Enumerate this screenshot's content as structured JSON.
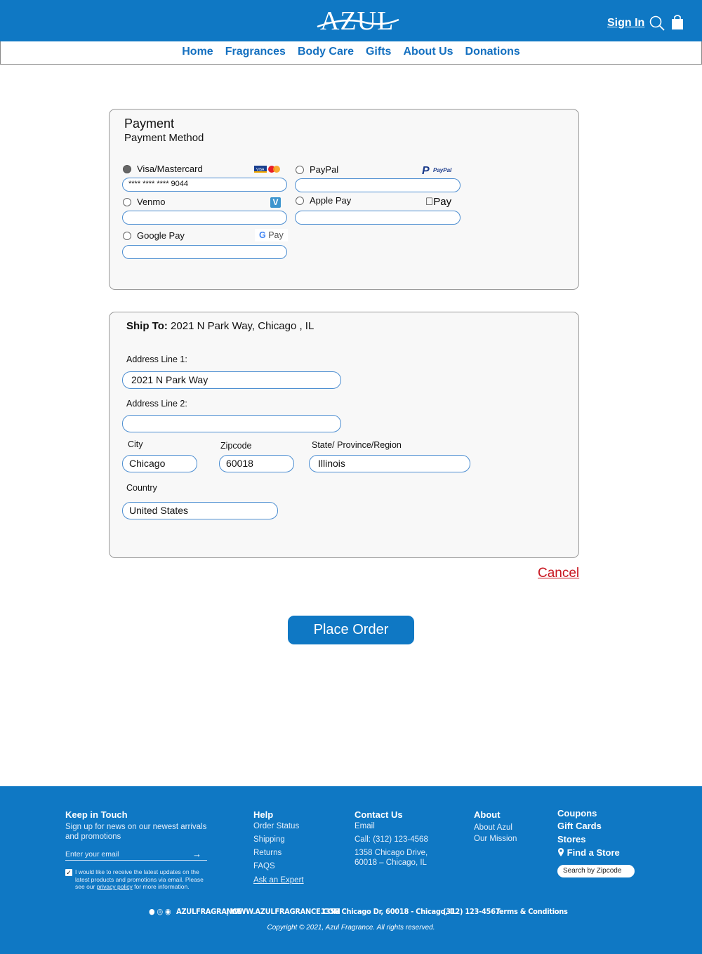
{
  "header": {
    "logo": "AZUL",
    "sign_in": "Sign In",
    "icons": [
      "search-icon",
      "shopping-bag-icon"
    ]
  },
  "nav": [
    "Home",
    "Fragrances",
    "Body Care",
    "Gifts",
    "About Us",
    "Donations"
  ],
  "payment": {
    "title": "Payment",
    "subtitle": "Payment Method",
    "options": [
      {
        "label": "Visa/Mastercard",
        "selected": true,
        "value": "**** **** **** 9044",
        "brand": "visa-mastercard-logo"
      },
      {
        "label": "PayPal",
        "selected": false,
        "value": "",
        "brand": "PayPal"
      },
      {
        "label": "Venmo",
        "selected": false,
        "value": "",
        "brand": "V"
      },
      {
        "label": "Apple Pay",
        "selected": false,
        "value": "",
        "brand": "Pay"
      },
      {
        "label": "Google Pay",
        "selected": false,
        "value": "",
        "brand": "Pay"
      }
    ]
  },
  "shipping": {
    "heading_label": "Ship To:",
    "heading_value": "2021 N Park Way,  Chicago , IL",
    "address1_label": "Address Line 1:",
    "address1": "2021 N Park Way",
    "address2_label": "Address Line 2:",
    "address2": "",
    "city_label": "City",
    "city": "Chicago",
    "zip_label": "Zipcode",
    "zip": "60018",
    "state_label": "State/ Province/Region",
    "state": "Illinois",
    "country_label": "Country",
    "country": "United States"
  },
  "actions": {
    "cancel": "Cancel",
    "place_order": "Place Order"
  },
  "footer": {
    "keep": {
      "title": "Keep in Touch",
      "text": "Sign up for news on our newest arrivals and promotions",
      "email_placeholder": "Enter your email",
      "consent_checked": true,
      "consent_a": "I would like to receive the latest updates on the latest products and promotions via email. Please see our ",
      "privacy": "privacy policy",
      "consent_b": " for more information."
    },
    "help": {
      "title": "Help",
      "links": [
        "Order Status",
        "Shipping",
        "Returns",
        "FAQS",
        "Ask an Expert"
      ]
    },
    "contact": {
      "title": "Contact Us",
      "email": "Email",
      "call": "Call: (312) 123-4568",
      "addr1": "1358 Chicago Drive,",
      "addr2": "60018 – Chicago, IL"
    },
    "about": {
      "title": "About",
      "links": [
        "About Azul",
        "Our Mission"
      ]
    },
    "extra": {
      "coupons": "Coupons",
      "gift_cards": "Gift Cards",
      "stores": "Stores",
      "find_store": "Find a Store",
      "zip_search": "Search by Zipcode"
    },
    "social_handle": "AZULFRAGRANCE",
    "website": "WWW.AZULFRAGRANCE.COM",
    "address": "1358 Chicago Dr,  60018 - Chicago, IL",
    "phone": "(312) 123-4567",
    "terms": "Terms & Conditions",
    "copyright": "Copyright © 2021, Azul Fragrance. All rights reserved."
  },
  "colors": {
    "brand": "#0f78c4",
    "cancel": "#c8141e",
    "field_border": "#4d8ed1"
  }
}
